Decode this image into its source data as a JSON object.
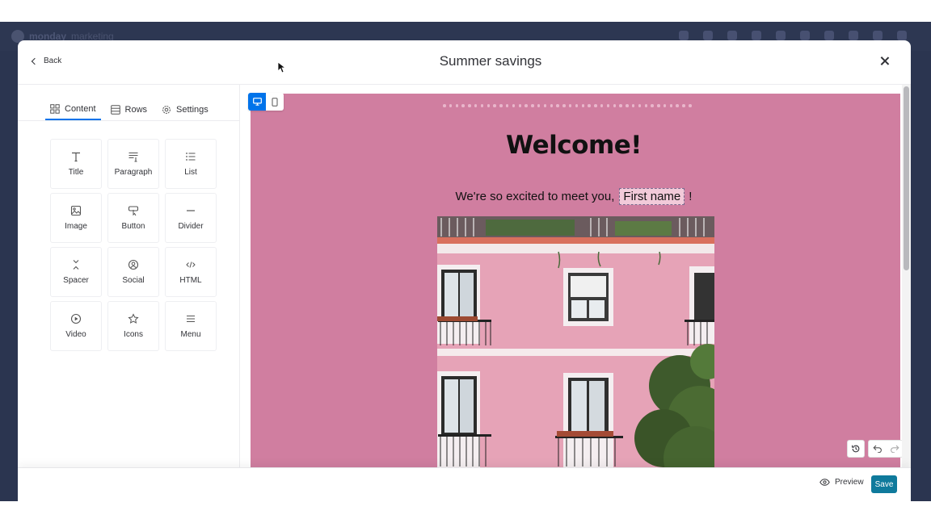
{
  "background": {
    "brand": "monday",
    "brand_sub": "marketing"
  },
  "header": {
    "back_label": "Back",
    "title": "Summer savings"
  },
  "tabs": [
    {
      "label": "Content",
      "icon": "grid-icon",
      "active": true
    },
    {
      "label": "Rows",
      "icon": "rows-icon",
      "active": false
    },
    {
      "label": "Settings",
      "icon": "gear-icon",
      "active": false
    }
  ],
  "blocks": [
    {
      "label": "Title",
      "icon": "title-icon"
    },
    {
      "label": "Paragraph",
      "icon": "paragraph-icon"
    },
    {
      "label": "List",
      "icon": "list-icon"
    },
    {
      "label": "Image",
      "icon": "image-icon"
    },
    {
      "label": "Button",
      "icon": "button-icon"
    },
    {
      "label": "Divider",
      "icon": "divider-icon"
    },
    {
      "label": "Spacer",
      "icon": "spacer-icon"
    },
    {
      "label": "Social",
      "icon": "social-icon"
    },
    {
      "label": "HTML",
      "icon": "code-icon"
    },
    {
      "label": "Video",
      "icon": "video-icon"
    },
    {
      "label": "Icons",
      "icon": "star-icon"
    },
    {
      "label": "Menu",
      "icon": "menu-icon"
    }
  ],
  "email": {
    "background_color": "#d07ea0",
    "heading": "Welcome!",
    "greeting_prefix": "We're so excited to meet you,",
    "merge_tag": "First name",
    "greeting_suffix": "!"
  },
  "footer": {
    "preview_label": "Preview",
    "save_label": "Save"
  },
  "colors": {
    "accent": "#0073ea",
    "save": "#0f7a9c"
  }
}
